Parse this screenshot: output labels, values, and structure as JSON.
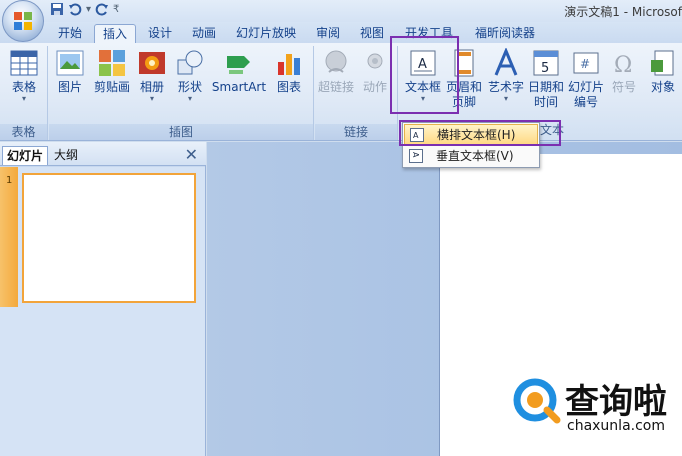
{
  "window": {
    "title": "演示文稿1 - Microsof"
  },
  "tabs": [
    {
      "label": "开始"
    },
    {
      "label": "插入"
    },
    {
      "label": "设计"
    },
    {
      "label": "动画"
    },
    {
      "label": "幻灯片放映"
    },
    {
      "label": "审阅"
    },
    {
      "label": "视图"
    },
    {
      "label": "开发工具"
    },
    {
      "label": "福昕阅读器"
    }
  ],
  "ribbon": {
    "groups": [
      {
        "label": "表格"
      },
      {
        "label": "插图"
      },
      {
        "label": "链接"
      },
      {
        "label": "文本"
      }
    ],
    "buttons": {
      "table": "表格",
      "picture": "图片",
      "clipart": "剪贴画",
      "album": "相册",
      "shapes": "形状",
      "smartart": "SmartArt",
      "chart": "图表",
      "hyperlink": "超链接",
      "action": "动作",
      "textbox": "文本框",
      "header_footer_1": "页眉和",
      "header_footer_2": "页脚",
      "wordart": "艺术字",
      "datetime_1": "日期和",
      "datetime_2": "时间",
      "slidenum_1": "幻灯片",
      "slidenum_2": "编号",
      "symbol": "符号",
      "object": "对象"
    }
  },
  "dropdown": {
    "items": [
      {
        "label": "横排文本框(H)"
      },
      {
        "label": "垂直文本框(V)"
      }
    ]
  },
  "pane": {
    "tabs": [
      {
        "label": "幻灯片"
      },
      {
        "label": "大纲"
      }
    ],
    "close": "✕",
    "slide_number": "1"
  },
  "watermark": {
    "brand": "查询啦",
    "url": "chaxunla.com"
  },
  "colors": {
    "accent": "#15428b",
    "highlight": "#7b2fb0",
    "selection": "#ffd985"
  }
}
